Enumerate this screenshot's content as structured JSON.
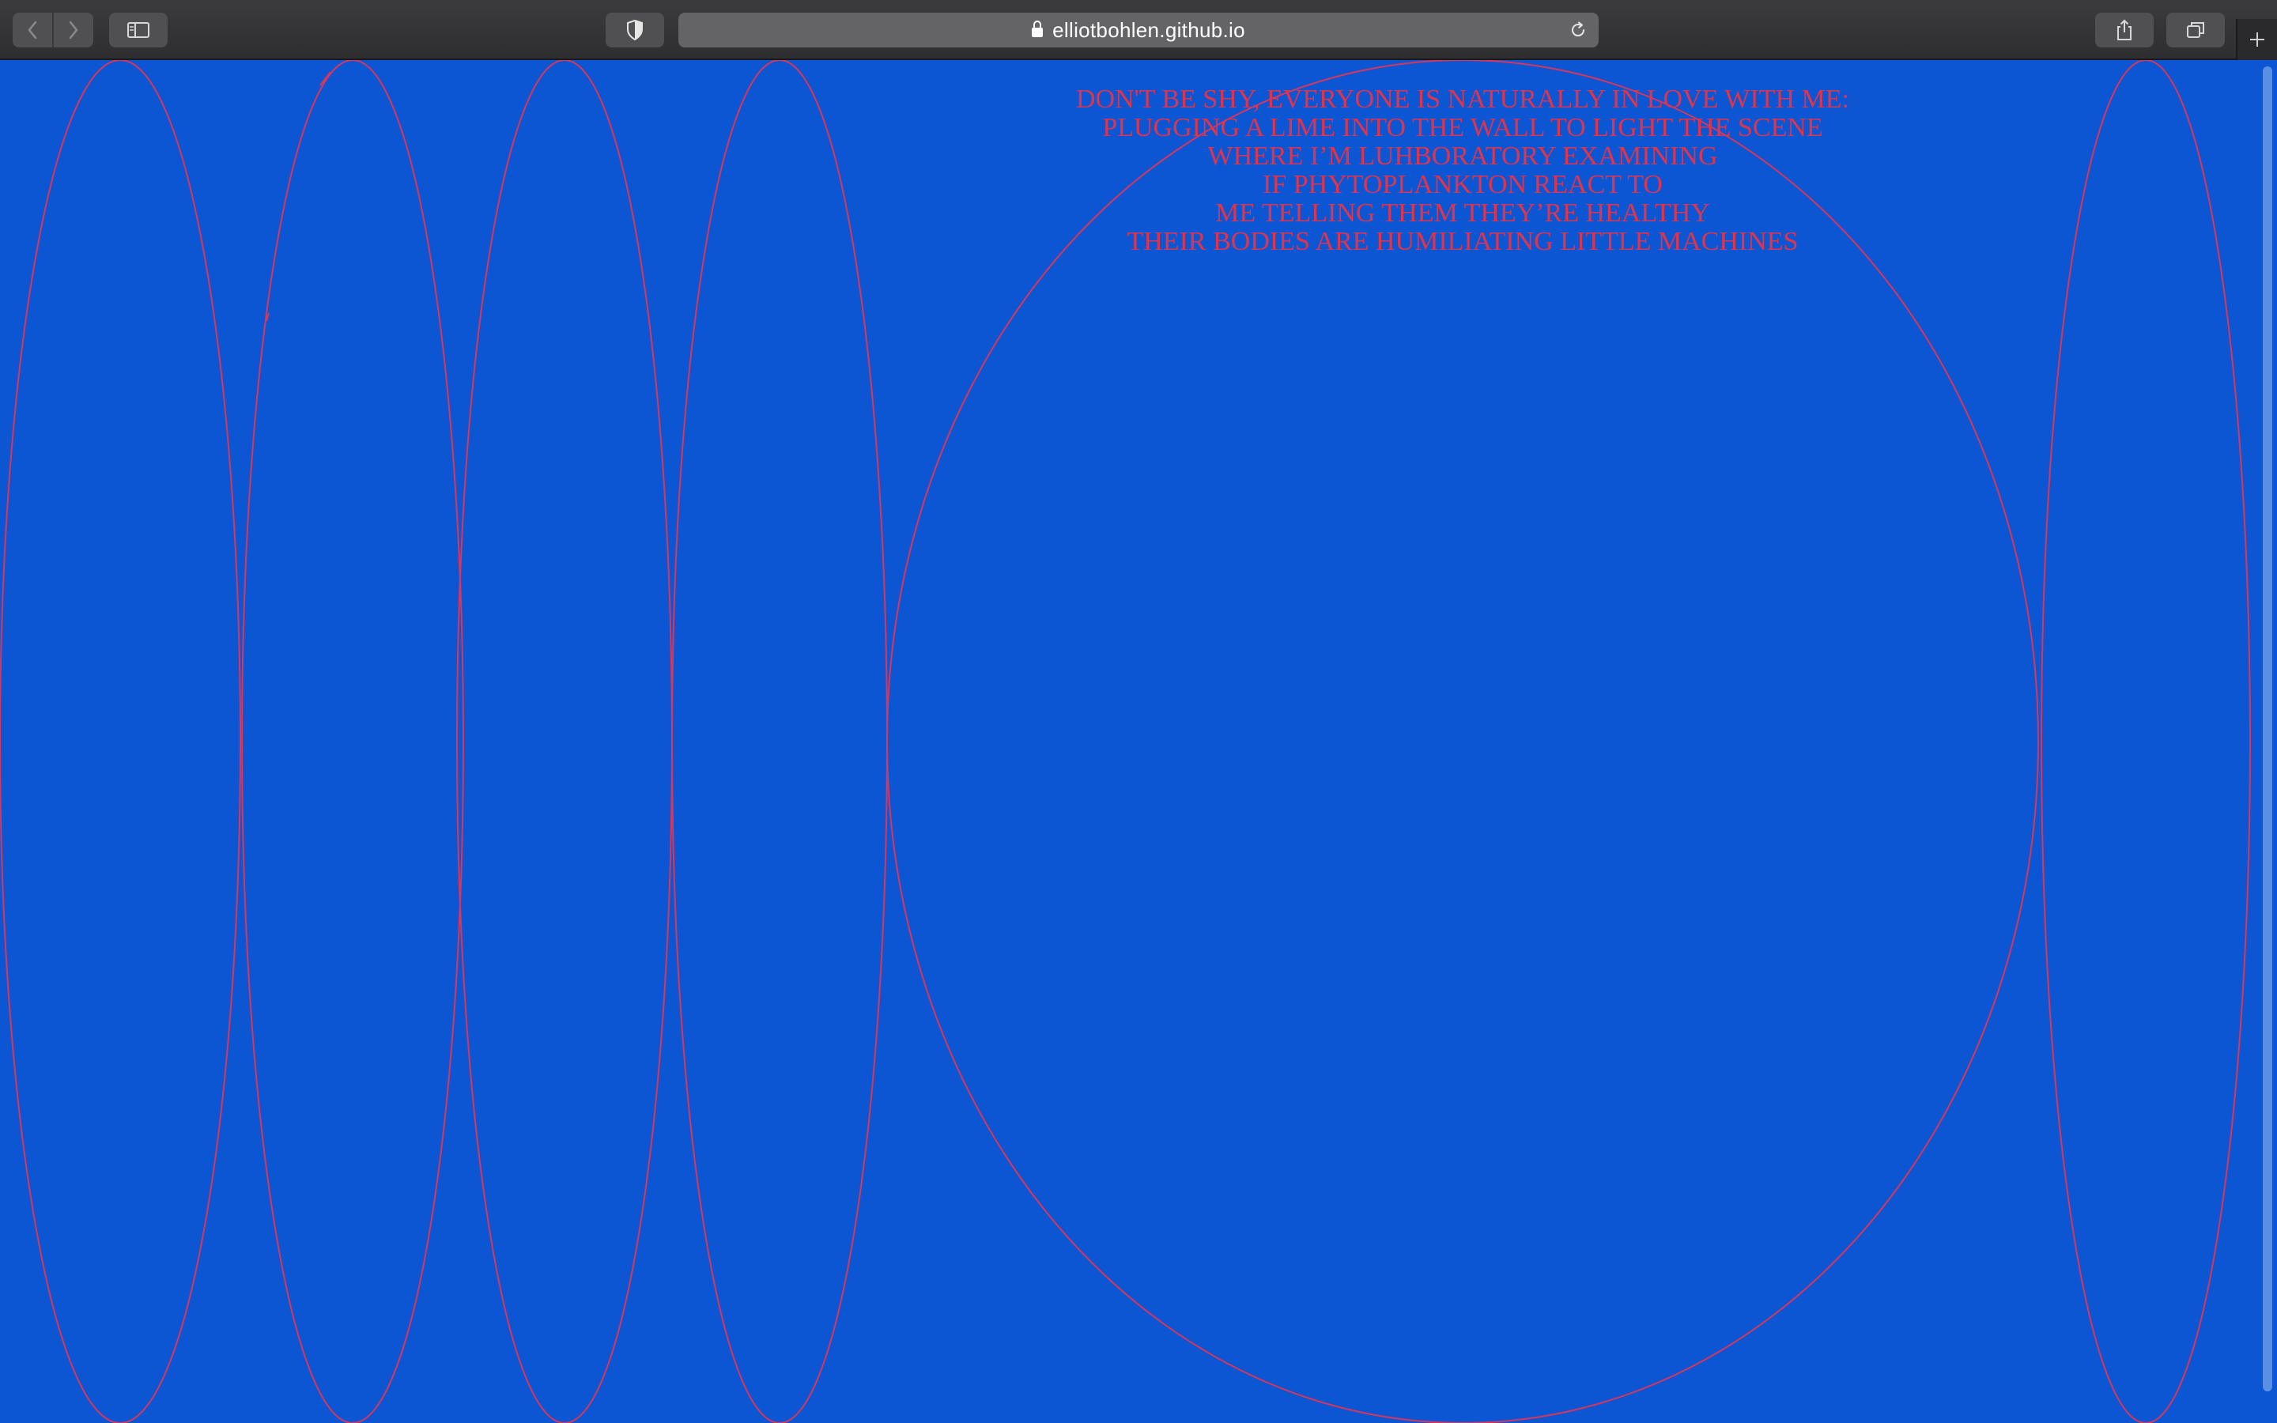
{
  "browser": {
    "url": "elliotbohlen.github.io",
    "icons": {
      "back": "chevron-left-icon",
      "forward": "chevron-right-icon",
      "sidebar": "sidebar-icon",
      "privacy": "shield-icon",
      "lock": "lock-icon",
      "reload": "reload-icon",
      "share": "share-icon",
      "tabs": "tabs-overview-icon",
      "new_tab": "plus-icon"
    }
  },
  "colors": {
    "page_background": "#0c56d4",
    "accent": "#e0344c"
  },
  "poem": {
    "lines": [
      "DON'T BE SHY, EVERYONE IS NATURALLY IN LOVE WITH ME:",
      "PLUGGING A LIME INTO THE WALL TO LIGHT THE SCENE",
      "WHERE I’M LUHBORATORY EXAMINING",
      "IF PHYTOPLANKTON REACT TO",
      "ME TELLING THEM THEY’RE HEALTHY",
      "THEIR BODIES ARE HUMILIATING LITTLE MACHINES"
    ]
  }
}
